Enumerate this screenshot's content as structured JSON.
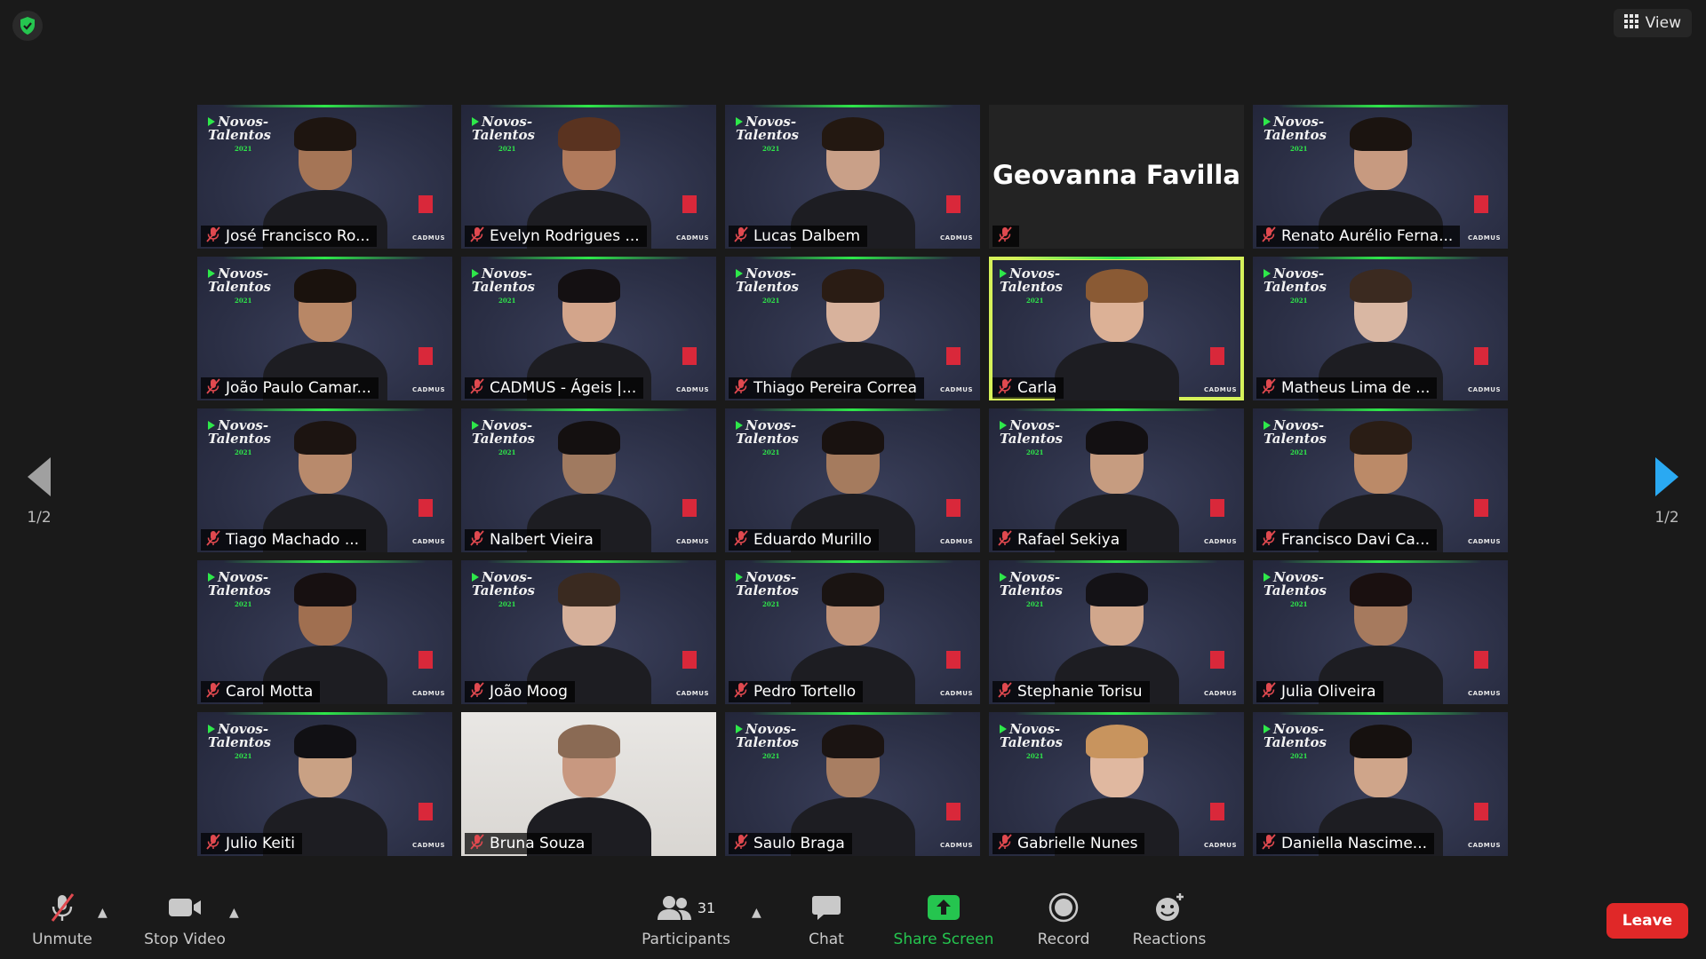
{
  "top": {
    "view_label": "View"
  },
  "pager": {
    "left_label": "1/2",
    "right_label": "1/2"
  },
  "tile_branding": {
    "logo_line1": "Novos-",
    "logo_line2": "Talentos",
    "logo_year": "2021",
    "brand": "CADMUS"
  },
  "participants": [
    {
      "name": "José Francisco Ro...",
      "style": "brand",
      "skin": "#a57556",
      "hair": "#1e1510"
    },
    {
      "name": "Evelyn Rodrigues ...",
      "style": "brand",
      "skin": "#b07a5c",
      "hair": "#5a3320"
    },
    {
      "name": "Lucas Dalbem",
      "style": "brand",
      "skin": "#c9a088",
      "hair": "#231811"
    },
    {
      "name": "Geovanna Favilla",
      "style": "plain",
      "big_name": "Geovanna Favilla"
    },
    {
      "name": "Renato Aurélio Ferna...",
      "style": "brand",
      "skin": "#c79a80",
      "hair": "#1b1410"
    },
    {
      "name": "João Paulo Camar...",
      "style": "brand",
      "skin": "#b88766",
      "hair": "#1a120d"
    },
    {
      "name": "CADMUS - Ágeis |...",
      "style": "brand",
      "skin": "#d3a58b",
      "hair": "#141012"
    },
    {
      "name": "Thiago Pereira Correa",
      "style": "brand",
      "skin": "#d8b29c",
      "hair": "#2a1c14"
    },
    {
      "name": "Carla",
      "style": "brand",
      "active": true,
      "skin": "#dcb196",
      "hair": "#8a5a34"
    },
    {
      "name": "Matheus Lima de ...",
      "style": "brand",
      "skin": "#d9b7a3",
      "hair": "#3b2a20"
    },
    {
      "name": "Tiago Machado ...",
      "style": "brand",
      "skin": "#b88a6c",
      "hair": "#1c1411"
    },
    {
      "name": "Nalbert Vieira",
      "style": "brand",
      "skin": "#a07a60",
      "hair": "#141010"
    },
    {
      "name": "Eduardo Murillo",
      "style": "brand",
      "skin": "#a57b5e",
      "hair": "#191210"
    },
    {
      "name": "Rafael Sekiya",
      "style": "brand",
      "skin": "#c69c80",
      "hair": "#131012"
    },
    {
      "name": "Francisco Davi Ca...",
      "style": "brand",
      "skin": "#bb8a68",
      "hair": "#2a1d15"
    },
    {
      "name": "Carol Motta",
      "style": "brand",
      "skin": "#a06f50",
      "hair": "#171011"
    },
    {
      "name": "João Moog",
      "style": "brand",
      "skin": "#d6b09a",
      "hair": "#3a2a20"
    },
    {
      "name": "Pedro Tortello",
      "style": "brand",
      "skin": "#c09378",
      "hair": "#1a1412"
    },
    {
      "name": "Stephanie Torisu",
      "style": "brand",
      "skin": "#d1a78c",
      "hair": "#141216"
    },
    {
      "name": "Julia Oliveira",
      "style": "brand",
      "skin": "#a67a5e",
      "hair": "#1a1010"
    },
    {
      "name": "Julio Keiti",
      "style": "brand",
      "skin": "#c9a184",
      "hair": "#111014"
    },
    {
      "name": "Bruna Souza",
      "style": "light",
      "skin": "#c89880",
      "hair": "#8a6a54"
    },
    {
      "name": "Saulo Braga",
      "style": "brand",
      "skin": "#a87e62",
      "hair": "#1b1412"
    },
    {
      "name": "Gabrielle Nunes",
      "style": "brand",
      "skin": "#e0b8a0",
      "hair": "#c8945e"
    },
    {
      "name": "Daniella Nascime...",
      "style": "brand",
      "skin": "#cfa58a",
      "hair": "#16110f"
    }
  ],
  "toolbar": {
    "unmute_label": "Unmute",
    "stop_video_label": "Stop Video",
    "participants_label": "Participants",
    "participants_count": "31",
    "chat_label": "Chat",
    "share_screen_label": "Share Screen",
    "record_label": "Record",
    "reactions_label": "Reactions",
    "leave_label": "Leave"
  },
  "colors": {
    "active_speaker_outline": "#d6f25a",
    "share_green": "#25c54f",
    "leave_red": "#e02828",
    "muted_red": "#e0494f"
  }
}
